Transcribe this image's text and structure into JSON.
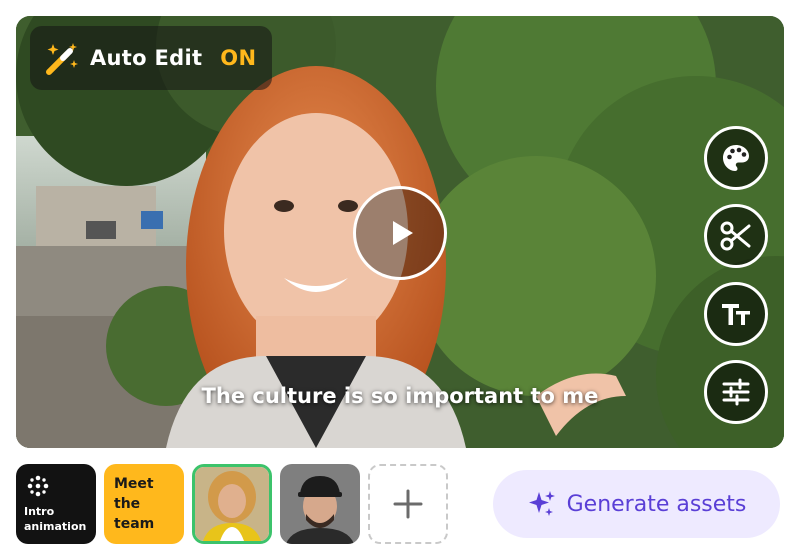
{
  "auto_edit": {
    "label": "Auto Edit",
    "status": "ON",
    "icon": "magic-wand-icon",
    "status_color": "#ffb81c"
  },
  "video": {
    "caption": "The culture is so important to me",
    "play_icon": "play-icon"
  },
  "side_tools": [
    {
      "name": "palette-icon"
    },
    {
      "name": "scissors-icon"
    },
    {
      "name": "text-size-icon"
    },
    {
      "name": "sliders-icon"
    }
  ],
  "thumbnails": {
    "intro": {
      "label_line1": "Intro",
      "label_line2": "animation"
    },
    "meet": {
      "label_line1": "Meet",
      "label_line2": "the",
      "label_line3": "team"
    },
    "add_icon": "plus-icon"
  },
  "generate": {
    "label": "Generate assets",
    "icon": "sparkles-icon",
    "color": "#5a3fd6",
    "background": "#eeeaff"
  },
  "colors": {
    "accent_green": "#3cc36b",
    "accent_yellow": "#ffb81c"
  }
}
